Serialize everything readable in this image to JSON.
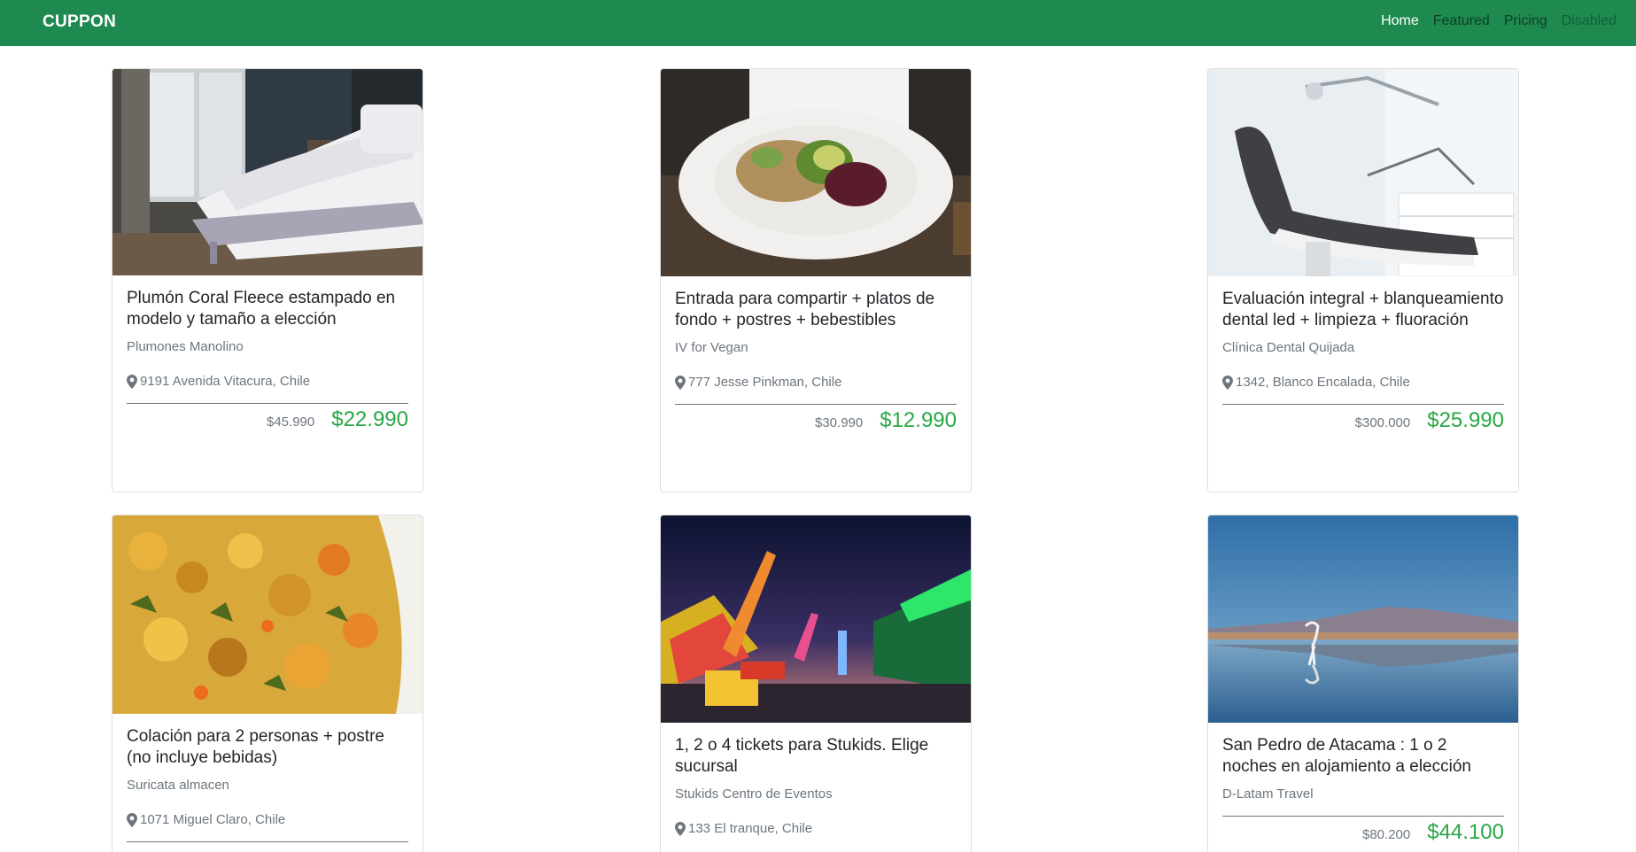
{
  "navbar": {
    "brand": "CUPPON",
    "links": [
      {
        "label": "Home",
        "state": "active"
      },
      {
        "label": "Featured",
        "state": "normal"
      },
      {
        "label": "Pricing",
        "state": "normal"
      },
      {
        "label": "Disabled",
        "state": "disabled"
      }
    ]
  },
  "colors": {
    "navbar_bg": "#1e8a4f",
    "price_new": "#28a745",
    "muted_text": "#6c757d"
  },
  "cards": [
    {
      "image_subject": "bedroom with bed and grey comforter",
      "title": "Plumón Coral Fleece estampado en modelo y tamaño a elección",
      "merchant": "Plumones Manolino",
      "location": "9191 Avenida Vitacura, Chile",
      "old_price": "$45.990",
      "new_price": "$22.990"
    },
    {
      "image_subject": "plate with quinoa salad and avocado",
      "title": "Entrada para compartir + platos de fondo + postres + bebestibles",
      "merchant": "IV for Vegan",
      "location": "777 Jesse Pinkman, Chile",
      "old_price": "$30.990",
      "new_price": "$12.990"
    },
    {
      "image_subject": "dental chair in clinic",
      "title": "Evaluación integral + blanqueamiento dental led + limpieza + fluoración",
      "merchant": "Clínica Dental Quijada",
      "location": "1342, Blanco Encalada, Chile",
      "old_price": "$300.000",
      "new_price": "$25.990"
    },
    {
      "image_subject": "vegetable stew dish",
      "title": "Colación para 2 personas + postre (no incluye bebidas)",
      "merchant": "Suricata almacen",
      "location": "1071 Miguel Claro, Chile",
      "old_price": "",
      "new_price": ""
    },
    {
      "image_subject": "amusement park at night",
      "title": "1, 2 o 4 tickets para Stukids. Elige sucursal",
      "merchant": "Stukids Centro de Eventos",
      "location": "133 El tranque, Chile",
      "old_price": "",
      "new_price": ""
    },
    {
      "image_subject": "flamingo at salt lake with volcano",
      "title": "San Pedro de Atacama : 1 o 2 noches en alojamiento a elección",
      "merchant": "D-Latam Travel",
      "location": "",
      "old_price": "$80.200",
      "new_price": "$44.100"
    }
  ]
}
